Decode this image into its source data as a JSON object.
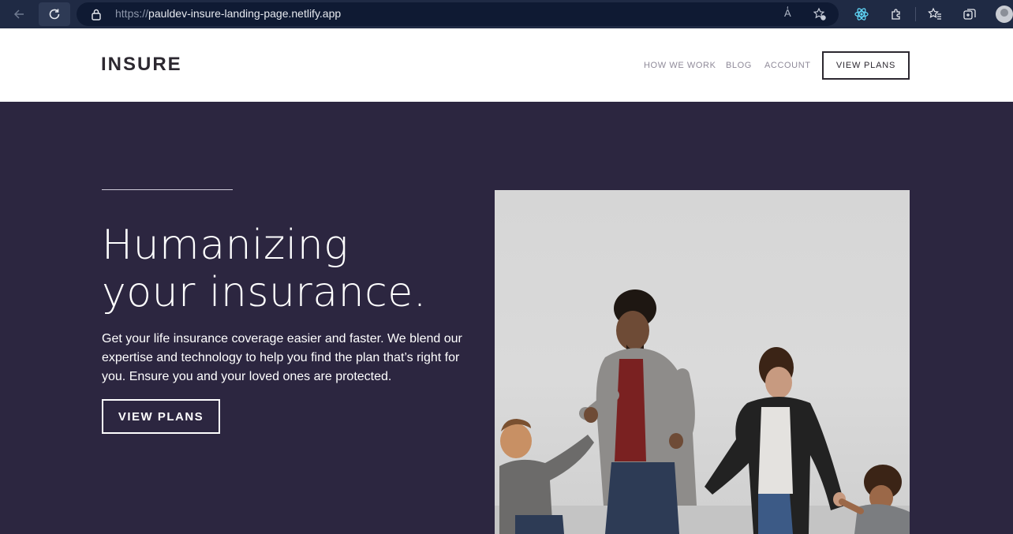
{
  "browser": {
    "url_prefix": "https://",
    "url_host": "pauldev-insure-landing-page.netlify.app",
    "read_aloud_label": "A̒"
  },
  "header": {
    "logo": "INSURE",
    "nav": {
      "how_we_work": "HOW WE WORK",
      "blog": "BLOG",
      "account": "ACCOUNT"
    },
    "cta": "VIEW PLANS"
  },
  "hero": {
    "title_line1": "Humanizing",
    "title_line2": "your insurance.",
    "text": "Get your life insurance coverage easier and faster. We blend our expertise and technology to help you find the plan that’s right for you. Ensure you and your loved ones are protected.",
    "cta": "VIEW PLANS",
    "image_alt_icon": "family-photo"
  },
  "colors": {
    "hero_bg": "#2c2640",
    "header_text": "#2c2830",
    "nav_text": "#8f8a99",
    "chrome_bg": "#1f2a44"
  }
}
